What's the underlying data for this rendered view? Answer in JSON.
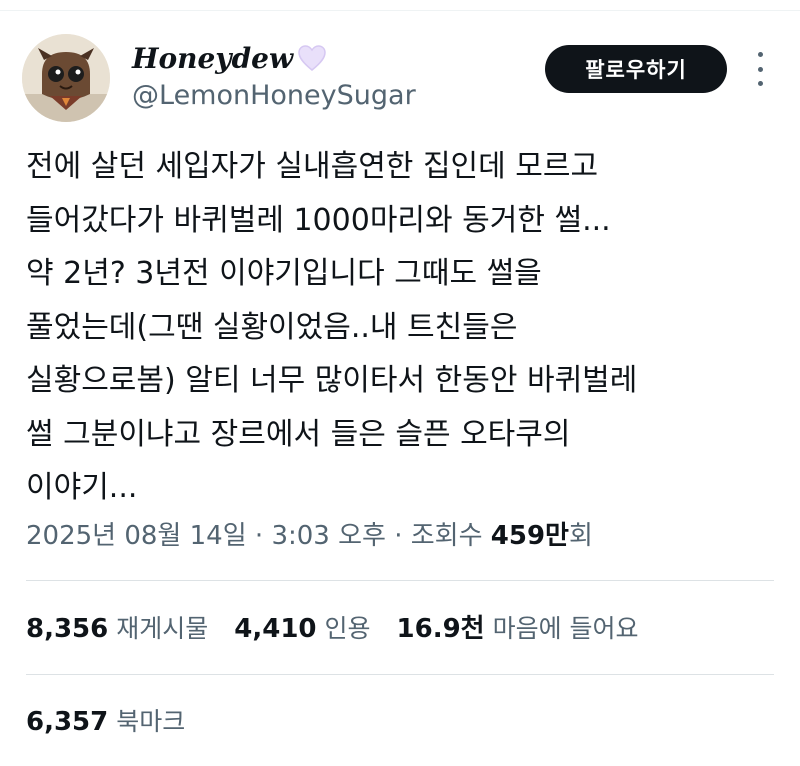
{
  "user": {
    "display_name": "Honeydew",
    "handle": "@LemonHoneySugar",
    "follow_label": "팔로우하기"
  },
  "tweet": {
    "lines": [
      "전에 살던 세입자가 실내흡연한 집인데 모르고",
      "들어갔다가 바퀴벌레 1000마리와 동거한 썰...",
      "약 2년? 3년전 이야기입니다 그때도 썰을",
      "풀었는데(그땐 실황이었음..내 트친들은",
      "실황으로봄) 알티 너무 많이타서 한동안 바퀴벌레",
      "썰 그분이냐고 장르에서 들은 슬픈 오타쿠의",
      "이야기..."
    ]
  },
  "meta": {
    "date": "2025년 08월 14일",
    "sep1": " · ",
    "time": "3:03 오후",
    "sep2": " · ",
    "views_label": "조회수 ",
    "views_value": "459만",
    "views_suffix": "회"
  },
  "stats": {
    "retweets_count": "8,356",
    "retweets_label": "재게시물",
    "quotes_count": "4,410",
    "quotes_label": "인용",
    "likes_count": "16.9천",
    "likes_label": "마음에 들어요",
    "bookmarks_count": "6,357",
    "bookmarks_label": "북마크"
  },
  "colors": {
    "follow_button_bg": "#0f1419",
    "secondary_text": "#536471",
    "heart": "#e9e0fa"
  },
  "icons": {
    "heart": "white-heart-icon",
    "more": "more-options-icon"
  }
}
